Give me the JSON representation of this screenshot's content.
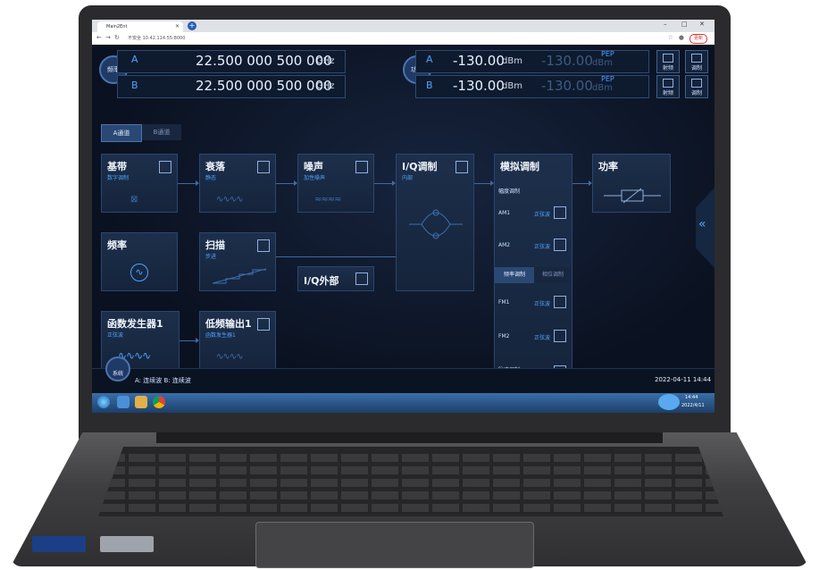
{
  "browser": {
    "tab_title": "Main2Ent",
    "url": "不安全 10.42.114.55:8000",
    "update_label": "更新"
  },
  "freq": {
    "cap_label": "频率",
    "a_label": "A",
    "b_label": "B",
    "a_value": "22.500 000 500 000",
    "b_value": "22.500 000 500 000",
    "unit": "GHz"
  },
  "power": {
    "cap_label": "功率",
    "a_label": "A",
    "b_label": "B",
    "a_value": "-130.00",
    "b_value": "-130.00",
    "unit": "dBm",
    "pep_label": "PEP",
    "pep_a_value": "-130.00",
    "pep_b_value": "-130.00",
    "pep_unit": "dBm"
  },
  "side_buttons": {
    "rf_a": "射频",
    "mod_a": "调制",
    "rf_b": "射频",
    "mod_b": "调制"
  },
  "channels": {
    "a": "A通道",
    "b": "B通道"
  },
  "blocks": {
    "baseband": {
      "title": "基带",
      "sub": "数字调制"
    },
    "fading": {
      "title": "衰落",
      "sub": "静态"
    },
    "noise": {
      "title": "噪声",
      "sub": "加性噪声"
    },
    "iq_mod": {
      "title": "I/Q调制",
      "sub": "内部"
    },
    "analog_mod": {
      "title": "模拟调制",
      "sub": "幅度调制"
    },
    "power": {
      "title": "功率"
    },
    "frequency": {
      "title": "频率"
    },
    "sweep": {
      "title": "扫描",
      "sub": "步进"
    },
    "iq_ext": {
      "title": "I/Q外部"
    },
    "funcgen": {
      "title": "函数发生器1",
      "sub": "正弦波"
    },
    "lf_out": {
      "title": "低频输出1",
      "sub": "函数发生器1"
    }
  },
  "analog": {
    "am1": "AM1",
    "am1_wave": "正弦波",
    "am2": "AM2",
    "am2_wave": "正弦波",
    "tab_fm": "频率调制",
    "tab_pm": "相位调制",
    "fm1": "FM1",
    "fm1_wave": "正弦波",
    "fm2": "FM2",
    "fm2_wave": "正弦波",
    "pulse": "脉冲调制",
    "pulse_sub": "自动"
  },
  "status": {
    "system_label": "系统",
    "sweep_status": "A: 连续波 B: 连续波",
    "datetime": "2022-04-11 14:44",
    "tray_time": "14:44",
    "tray_date": "2022/4/11"
  },
  "colors": {
    "accent": "#4da3ff",
    "panel": "#1d2f4b",
    "background": "#0b1220"
  }
}
